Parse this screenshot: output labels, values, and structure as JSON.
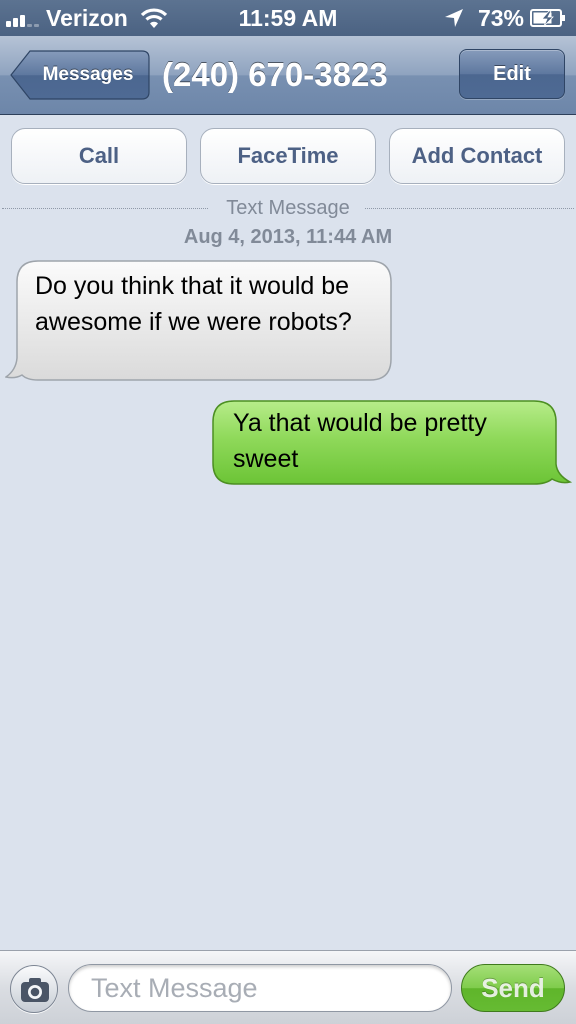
{
  "status_bar": {
    "carrier": "Verizon",
    "time": "11:59 AM",
    "battery_percent": "73%",
    "signal_bars_filled": 3,
    "signal_bars_total": 5,
    "icons": [
      "signal-icon",
      "wifi-icon",
      "location-arrow-icon",
      "battery-charging-icon"
    ]
  },
  "nav": {
    "back_label": "Messages",
    "title": "(240) 670-3823",
    "edit_label": "Edit"
  },
  "actions": {
    "call_label": "Call",
    "facetime_label": "FaceTime",
    "add_contact_label": "Add Contact"
  },
  "conversation": {
    "type_label": "Text Message",
    "timestamp": "Aug 4, 2013, 11:44 AM",
    "messages": [
      {
        "direction": "received",
        "text": "Do you think that it would be awesome if we were robots?"
      },
      {
        "direction": "sent",
        "text": "Ya that would be pretty sweet"
      }
    ]
  },
  "compose": {
    "placeholder": "Text Message",
    "value": "",
    "send_label": "Send",
    "camera_icon": "camera-icon"
  },
  "colors": {
    "background": "#dbe2ed",
    "nav_bar": "#7890b1",
    "received_bubble": "#e8e8e8",
    "sent_bubble": "#7fcf45",
    "button_text": "#4d6185",
    "send_button": "#66bb33"
  }
}
